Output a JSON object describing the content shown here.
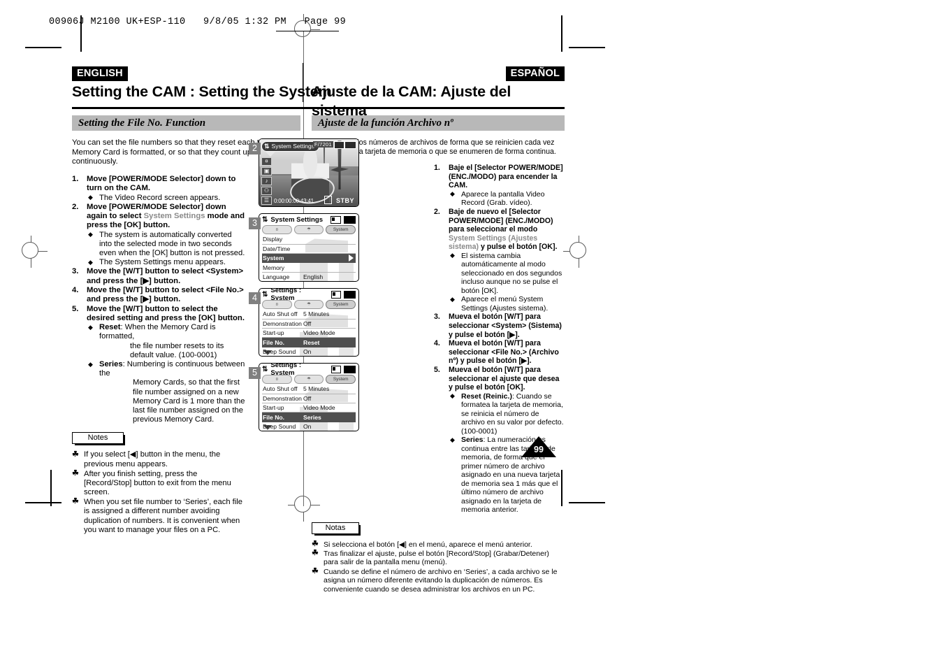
{
  "slug": {
    "text": "00906J M2100 UK+ESP-110   9/8/05 1:32 PM   Page 99"
  },
  "badges": {
    "english": "ENGLISH",
    "spanish": "ESPAÑOL"
  },
  "titles": {
    "english": "Setting the CAM : Setting the System",
    "spanish": "Ajuste de la CAM: Ajuste del sistema"
  },
  "section": {
    "english": "Setting the File No. Function",
    "spanish": "Ajuste de la función Archivo nº"
  },
  "english": {
    "intro": "You can set the file numbers so that they reset each time Memory Card is formatted, or so that they count up continuously.",
    "steps": [
      {
        "num": "1.",
        "text": "Move [POWER/MODE Selector] down to turn on the CAM.",
        "subs": [
          "The Video Record screen appears."
        ]
      },
      {
        "num": "2.",
        "pre": "Move [POWER/MODE Selector] down again to select ",
        "soft": "System Settings",
        "post": " mode and press the [OK] button.",
        "subs": [
          "The system is automatically converted into the selected mode in two seconds even when the [OK] button is not pressed.",
          "The System Settings menu appears."
        ]
      },
      {
        "num": "3.",
        "text": "Move the [W/T] button to select <System> and press the [▶] button.",
        "subs": []
      },
      {
        "num": "4.",
        "text": "Move the [W/T] button to select <File No.> and press the [▶] button.",
        "subs": []
      },
      {
        "num": "5.",
        "text": "Move the [W/T] button to select the desired setting and press the [OK] button.",
        "defs": [
          {
            "term": "Reset",
            "body": ": When the Memory Card is formatted,",
            "cont": "the file number resets to its default value. (100-0001)"
          },
          {
            "term": "Series",
            "body": ": Numbering is continuous between the",
            "cont": "Memory Cards, so that the first file number assigned on a new Memory Card is 1 more than the last file number assigned on the previous Memory Card."
          }
        ]
      }
    ],
    "notes_label": "Notes",
    "notes": [
      "If you select [◀] button in the menu, the previous menu appears.",
      "After you finish setting, press the [Record/Stop] button to exit from the menu screen.",
      "When you set file number to ‘Series’, each file is assigned a different number avoiding duplication of numbers. It is convenient when you want to manage your files on a PC."
    ]
  },
  "spanish": {
    "intro": "Puede definir los números de archivos de forma que se reinicien cada vez que formatee la tarjeta de memoria o que se enumeren de forma continua.",
    "steps": [
      {
        "num": "1.",
        "text": "Baje el [Selector POWER/MODE] (ENC./MODO) para encender la CAM.",
        "subs": [
          "Aparece la pantalla Video Record (Grab. vídeo)."
        ]
      },
      {
        "num": "2.",
        "pre": "Baje de nuevo el [Selector POWER/MODE] (ENC./MODO) para seleccionar el modo ",
        "soft": "System Settings (Ajustes sistema)",
        "post": " y pulse el botón [OK].",
        "subs": [
          "El sistema cambia automáticamente al modo seleccionado en dos segundos incluso aunque no se pulse el botón [OK].",
          "Aparece el menú System Settings (Ajustes sistema)."
        ]
      },
      {
        "num": "3.",
        "text": "Mueva el botón [W/T] para seleccionar <System> (Sistema) y pulse el botón [▶].",
        "subs": []
      },
      {
        "num": "4.",
        "text": "Mueva el botón [W/T] para seleccionar <File No.> (Archivo nº) y pulse el botón [▶].",
        "subs": []
      },
      {
        "num": "5.",
        "text": "Mueva el botón [W/T] para seleccionar el ajuste que desea y pulse el botón [OK].",
        "defs": [
          {
            "term": "Reset (Reinic.)",
            "body": ": Cuando se formatea la tarjeta de memoria, se reinicia el número de archivo en su valor por defecto. (100-0001)",
            "cont": ""
          },
          {
            "term": "Series",
            "body": ": La numeración es continua entre las tarjetas de memoria, de forma que el primer número de archivo asignado en una nueva tarjeta de memoria sea 1 más que el último número de archivo asignado en la tarjeta de memoria anterior.",
            "cont": ""
          }
        ]
      }
    ],
    "notes_label": "Notas",
    "notes": [
      "Si selecciona el botón [◀] en el menú, aparece el menú anterior.",
      "Tras finalizar el ajuste, pulse el botón [Record/Stop] (Grabar/Detener) para salir de la pantalla menu (menú).",
      "Cuando se define el número de archivo en ‘Series’, a cada archivo se le asigna un número diferente evitando la duplicación de números. Es conveniente cuando se desea administrar los archivos en un PC."
    ]
  },
  "figures": [
    {
      "num": "2",
      "kind": "preview",
      "osd_title": "System Settings",
      "osd_f": "F/7201",
      "osd_timecode": "0:00:00:00:43:41",
      "osd_stby": "STBY",
      "rail": [
        "¤",
        "▣",
        "♪",
        "⚇",
        "☰"
      ]
    },
    {
      "num": "3",
      "kind": "menu",
      "header": "System Settings",
      "tabs": [
        "¤",
        "☂",
        "System"
      ],
      "active_tab_index": 2,
      "rows": [
        {
          "label": "Display",
          "value": "",
          "selected": false
        },
        {
          "label": "Date/Time",
          "value": "",
          "selected": false
        },
        {
          "label": "System",
          "value": "",
          "selected": true,
          "arrow": true
        },
        {
          "label": "Memory",
          "value": "",
          "selected": false
        },
        {
          "label": "Language",
          "value": "English",
          "selected": false
        }
      ],
      "scroll_down": false
    },
    {
      "num": "4",
      "kind": "menu",
      "header": "Settings : System",
      "tabs": [
        "¤",
        "☂",
        "System"
      ],
      "active_tab_index": 2,
      "rows": [
        {
          "label": "Auto Shut off",
          "value": "5 Minutes",
          "selected": false
        },
        {
          "label": "Demonstration",
          "value": "Off",
          "selected": false
        },
        {
          "label": "Start-up",
          "value": "Video Mode",
          "selected": false
        },
        {
          "label": "File No.",
          "value": "Reset",
          "selected": true
        },
        {
          "label": "Beep Sound",
          "value": "On",
          "selected": false
        }
      ],
      "scroll_down": true
    },
    {
      "num": "5",
      "kind": "menu",
      "header": "Settings : System",
      "tabs": [
        "¤",
        "☂",
        "System"
      ],
      "active_tab_index": 2,
      "rows": [
        {
          "label": "Auto Shut off",
          "value": "5 Minutes",
          "selected": false
        },
        {
          "label": "Demonstration",
          "value": "Off",
          "selected": false
        },
        {
          "label": "Start-up",
          "value": "Video Mode",
          "selected": false
        },
        {
          "label": "File No.",
          "value": "Series",
          "selected": true
        },
        {
          "label": "Beep Sound",
          "value": "On",
          "selected": false
        }
      ],
      "scroll_down": true
    }
  ],
  "page_number": "99"
}
